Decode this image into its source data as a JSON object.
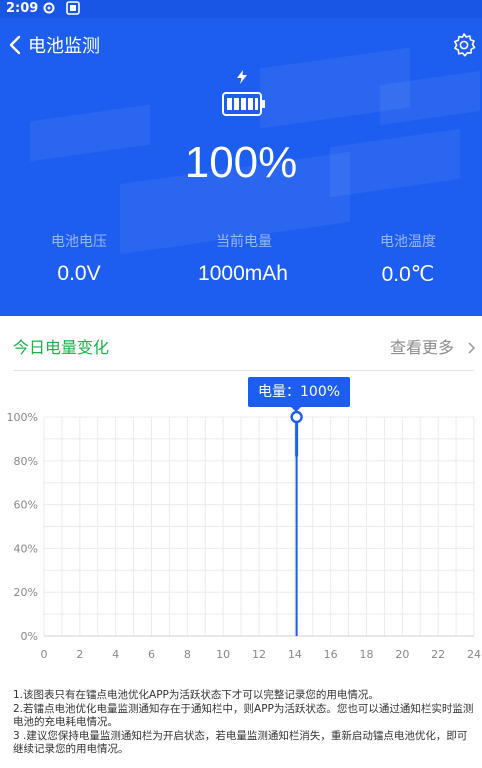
{
  "status_bar": {
    "time": "2:09"
  },
  "header": {
    "title": "电池监测"
  },
  "battery": {
    "percent": "100%"
  },
  "stats": [
    {
      "label": "电池电压",
      "value": "0.0V"
    },
    {
      "label": "当前电量",
      "value": "1000mAh"
    },
    {
      "label": "电池温度",
      "value": "0.0℃"
    }
  ],
  "section": {
    "title": "今日电量变化",
    "more_label": "查看更多"
  },
  "tooltip": {
    "text": "电量：100%"
  },
  "chart_data": {
    "type": "line",
    "title": "",
    "xlabel": "",
    "ylabel": "",
    "x_ticks": [
      "0",
      "2",
      "4",
      "6",
      "8",
      "10",
      "12",
      "14",
      "16",
      "18",
      "20",
      "22",
      "24"
    ],
    "y_ticks": [
      "0%",
      "20%",
      "40%",
      "60%",
      "80%",
      "100%"
    ],
    "xlim": [
      0,
      24
    ],
    "ylim": [
      0,
      100
    ],
    "grid": true,
    "series": [
      {
        "points": [
          [
            14.1,
            100
          ],
          [
            14.1,
            82
          ]
        ]
      }
    ],
    "marker": {
      "x": 14.1,
      "y": 100
    },
    "cursor_x": 14.1,
    "colors": {
      "line": "#1d5df0",
      "grid": "#ebebeb"
    }
  },
  "notes": [
    "1.该图表只有在镭点电池优化APP为活跃状态下才可以完整记录您的用电情况。",
    "2.若镭点电池优化电量监测通知存在于通知栏中，则APP为活跃状态。您也可以通过通知栏实时监测电池的充电耗电情况。",
    "3 .建议您保持电量监测通知栏为开启状态，若电量监测通知栏消失，重新启动镭点电池优化，即可继续记录您的用电情况。"
  ],
  "colors": {
    "brand": "#1d5df0",
    "accent_green": "#19b34a"
  }
}
